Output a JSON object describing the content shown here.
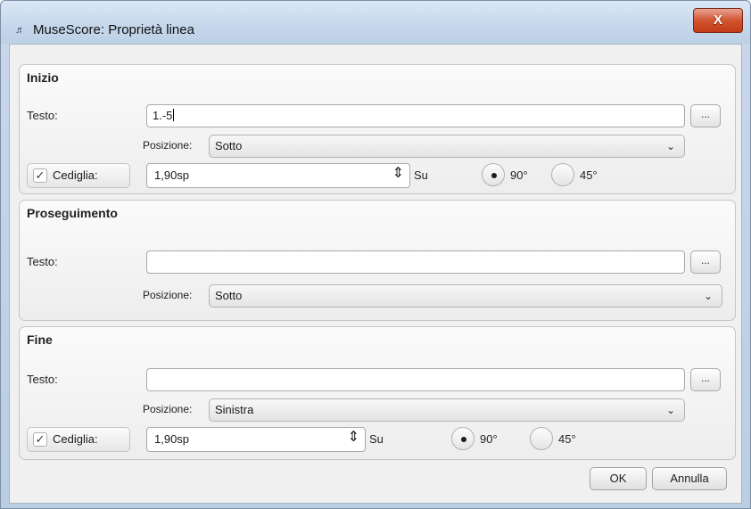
{
  "window": {
    "title": "MuseScore: Proprietà linea",
    "app_icon_glyph": "♬",
    "close_glyph": "X"
  },
  "labels": {
    "testo": "Testo:",
    "posizione": "Posizione:",
    "cediglia": "Cediglia:",
    "su": "Su",
    "deg90": "90°",
    "deg45": "45°",
    "dots": "..."
  },
  "inizio": {
    "title": "Inizio",
    "testo_value": "1.-5",
    "posizione": "Sotto",
    "cediglia_checked": true,
    "cediglia_value": "1,90sp",
    "angle_selected": "90°"
  },
  "proseguimento": {
    "title": "Proseguimento",
    "testo_value": "",
    "posizione": "Sotto"
  },
  "fine": {
    "title": "Fine",
    "testo_value": "",
    "posizione": "Sinistra",
    "cediglia_checked": true,
    "cediglia_value": "1,90sp",
    "angle_selected": "90°"
  },
  "buttons": {
    "ok": "OK",
    "cancel": "Annulla"
  },
  "icons": {
    "checkmark": "check-icon",
    "chevron": "chevron-down-icon",
    "spin": "spin-updown-icon"
  },
  "colors": {
    "close_button": "#d2532f",
    "titlebar": "#c7d8ec",
    "dialog_bg": "#f0f0f0"
  }
}
